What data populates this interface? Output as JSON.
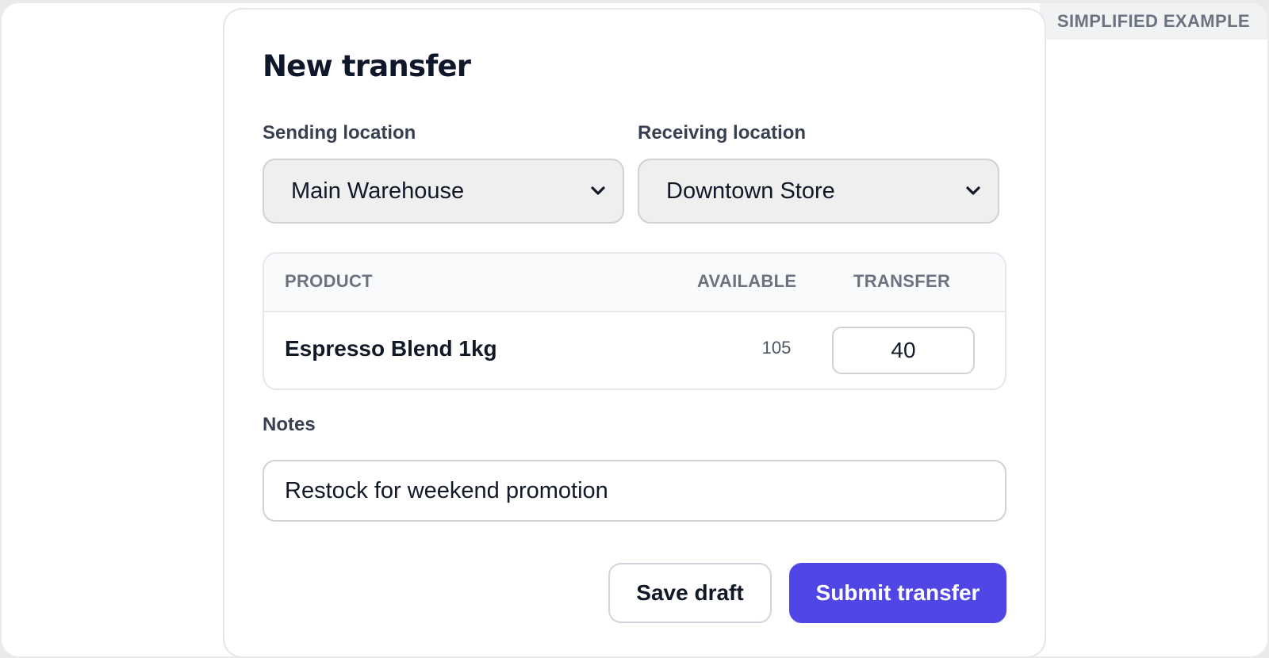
{
  "badge": {
    "label": "SIMPLIFIED EXAMPLE"
  },
  "form": {
    "title": "New transfer",
    "sending": {
      "label": "Sending location",
      "value": "Main Warehouse"
    },
    "receiving": {
      "label": "Receiving location",
      "value": "Downtown Store"
    },
    "table": {
      "headers": {
        "product": "PRODUCT",
        "available": "AVAILABLE",
        "transfer": "TRANSFER"
      },
      "rows": [
        {
          "product": "Espresso Blend 1kg",
          "available": "105",
          "transfer": "40"
        }
      ]
    },
    "notes": {
      "label": "Notes",
      "value": "Restock for weekend promotion"
    },
    "buttons": {
      "save_draft": "Save draft",
      "submit": "Submit transfer"
    }
  },
  "colors": {
    "primary": "#4f46e5",
    "badge_text": "#6b7280"
  },
  "icons": {
    "select_chevron": "chevron-down-icon"
  }
}
